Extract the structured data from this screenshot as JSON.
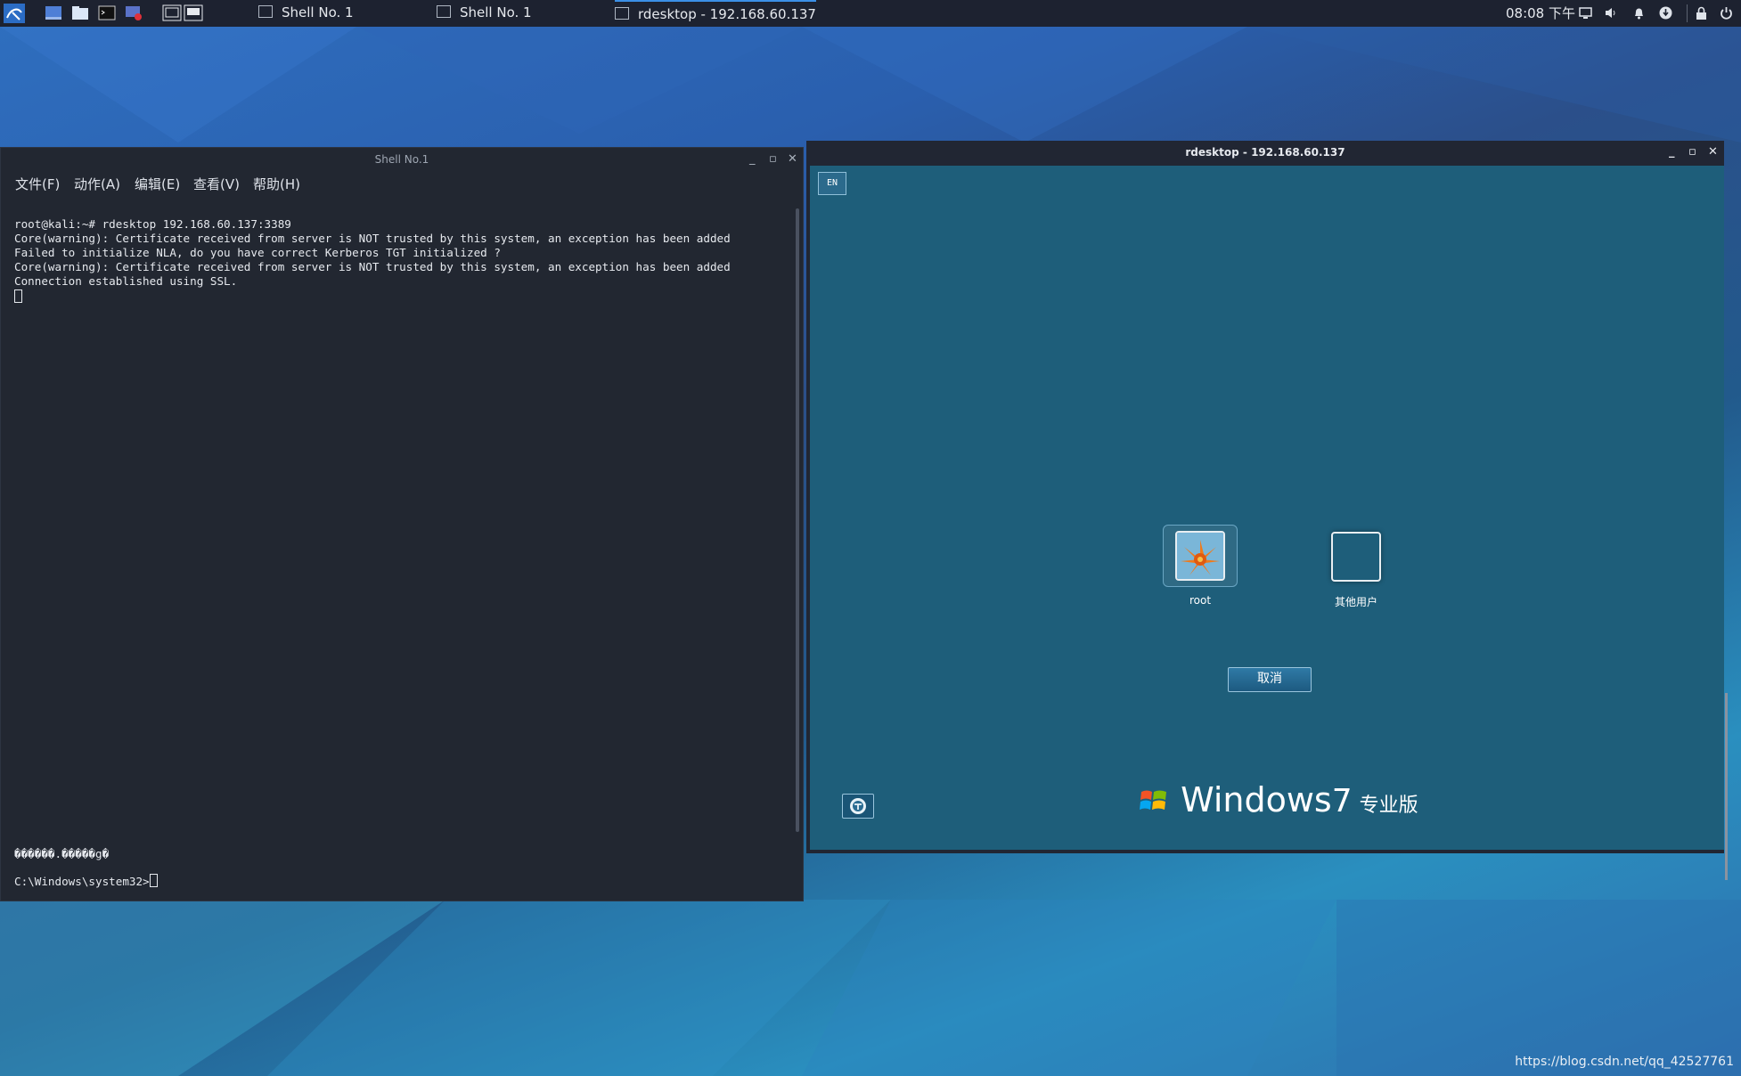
{
  "taskbar": {
    "tasks": [
      {
        "label": "Shell No. 1"
      },
      {
        "label": "Shell No. 1"
      },
      {
        "label": "rdesktop - 192.168.60.137"
      }
    ],
    "clock": "08:08 下午"
  },
  "shell_window": {
    "title": "Shell No.1",
    "menu": [
      "文件(F)",
      "动作(A)",
      "编辑(E)",
      "查看(V)",
      "帮助(H)"
    ],
    "lines": [
      "root@kali:~# rdesktop 192.168.60.137:3389",
      "Core(warning): Certificate received from server is NOT trusted by this system, an exception has been added",
      "",
      "Failed to initialize NLA, do you have correct Kerberos TGT initialized ?",
      "Core(warning): Certificate received from server is NOT trusted by this system, an exception has been added",
      "Connection established using SSL."
    ],
    "bottom_line_1": "������.�����g�",
    "prompt": "C:\\Windows\\system32>"
  },
  "rdp_window": {
    "title": "rdesktop - 192.168.60.137",
    "lang_indicator": "EN",
    "users": [
      {
        "label": "root"
      },
      {
        "label": "其他用户"
      }
    ],
    "cancel_label": "取消",
    "brand_windows": "Windows",
    "brand_version": "7",
    "brand_edition": "专业版"
  },
  "watermark": "https://blog.csdn.net/qq_42527761"
}
